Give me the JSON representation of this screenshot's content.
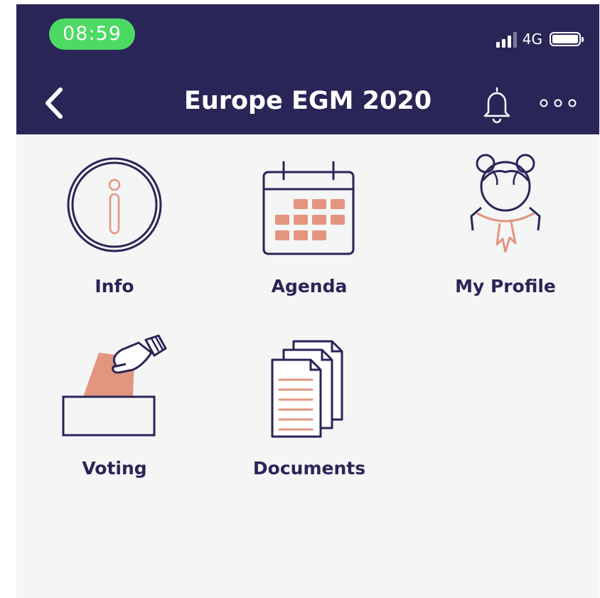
{
  "status_bar": {
    "time": "08:59",
    "network": "4G"
  },
  "header": {
    "title": "Europe EGM 2020",
    "icons": [
      "chevron-left-icon",
      "bell-icon",
      "more-dots-icon"
    ]
  },
  "menu": {
    "items": [
      {
        "label": "Info",
        "icon": "info-icon"
      },
      {
        "label": "Agenda",
        "icon": "calendar-icon"
      },
      {
        "label": "My Profile",
        "icon": "profile-icon"
      },
      {
        "label": "Voting",
        "icon": "ballot-box-icon"
      },
      {
        "label": "Documents",
        "icon": "documents-icon"
      }
    ]
  },
  "colors": {
    "header_bg": "#2a2557",
    "accent": "#e39580",
    "time_pill": "#4cd964",
    "page_bg": "#f4f5f5",
    "label": "#2a2557"
  }
}
